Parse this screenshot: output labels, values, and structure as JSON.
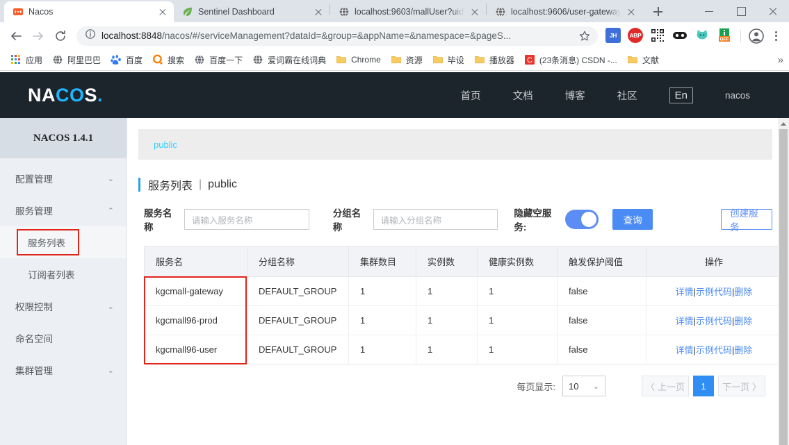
{
  "browser": {
    "tabs": [
      {
        "title": "Nacos",
        "favicon": "nacos-icon",
        "active": true
      },
      {
        "title": "Sentinel Dashboard",
        "favicon": "leaf-icon",
        "active": false
      },
      {
        "title": "localhost:9603/mallUser?uid",
        "favicon": "globe-icon",
        "active": false
      },
      {
        "title": "localhost:9606/user-gateway",
        "favicon": "globe-icon",
        "active": false
      }
    ],
    "new_tab_label": "+",
    "window_controls": {
      "minimize": "minimize-icon",
      "maximize": "maximize-icon",
      "close": "close-icon"
    },
    "omnibox": {
      "host": "localhost:8848",
      "path": "/nacos/#/serviceManagement?dataId=&group=&appName=&namespace=&pageS...",
      "info_icon": "info-circle-icon",
      "bookmark_icon": "star-icon"
    },
    "nav": {
      "back": "back-arrow-icon",
      "forward": "forward-arrow-icon",
      "reload": "reload-icon"
    },
    "extensions": [
      {
        "name": "JH",
        "label": "JH",
        "color": "#3f6fd8"
      },
      {
        "name": "ABP",
        "label": "ABP",
        "color": "#e02a2a"
      },
      {
        "name": "qr-code",
        "label": "",
        "color": "#2b2b2b"
      },
      {
        "name": "pocket",
        "label": "",
        "color": "#1a1a1a"
      },
      {
        "name": "cat",
        "label": "",
        "color": "#49c9bc"
      },
      {
        "name": "proxy-off",
        "label": "OFF",
        "color": "#1aa052"
      }
    ],
    "profile_icon": "account-circle-icon",
    "menu_icon": "three-dots-icon",
    "bookmarks": [
      {
        "label": "应用",
        "icon": "apps-grid-icon"
      },
      {
        "label": "阿里巴巴",
        "icon": "globe-icon"
      },
      {
        "label": "百度",
        "icon": "baidu-paw-icon"
      },
      {
        "label": "搜索",
        "icon": "search-o-icon"
      },
      {
        "label": "百度一下",
        "icon": "globe-icon"
      },
      {
        "label": "爱词霸在线词典",
        "icon": "globe-icon"
      },
      {
        "label": "Chrome",
        "icon": "folder-icon"
      },
      {
        "label": "资源",
        "icon": "folder-icon"
      },
      {
        "label": "毕设",
        "icon": "folder-icon"
      },
      {
        "label": "播放器",
        "icon": "folder-icon"
      },
      {
        "label": "(23条消息) CSDN -...",
        "icon": "csdn-icon"
      },
      {
        "label": "文献",
        "icon": "folder-icon"
      }
    ],
    "bookmarks_overflow": "»"
  },
  "nacos": {
    "logo": {
      "part1": "NA",
      "part2": "CO",
      "part3": "S",
      "dot": "."
    },
    "topnav": [
      {
        "label": "首页"
      },
      {
        "label": "文档"
      },
      {
        "label": "博客"
      },
      {
        "label": "社区"
      }
    ],
    "lang_button": "En",
    "username": "nacos",
    "sidebar": {
      "title": "NACOS 1.4.1",
      "items": [
        {
          "label": "配置管理",
          "chevron": "⌄",
          "type": "group"
        },
        {
          "label": "服务管理",
          "chevron": "⌃",
          "type": "group"
        },
        {
          "label": "服务列表",
          "type": "sub",
          "selected": true
        },
        {
          "label": "订阅者列表",
          "type": "sub",
          "selected": false
        },
        {
          "label": "权限控制",
          "chevron": "⌄",
          "type": "group"
        },
        {
          "label": "命名空间",
          "chevron": "",
          "type": "group"
        },
        {
          "label": "集群管理",
          "chevron": "⌄",
          "type": "group"
        }
      ]
    },
    "breadcrumb": "public",
    "page_title": {
      "text": "服务列表",
      "separator": "|",
      "namespace": "public"
    },
    "filters": {
      "service_name_label": "服务名称",
      "service_name_placeholder": "请输入服务名称",
      "service_name_value": "",
      "group_name_label": "分组名称",
      "group_name_placeholder": "请输入分组名称",
      "group_name_value": "",
      "hide_empty_label": "隐藏空服务:",
      "hide_empty_on": true,
      "query_button": "查询",
      "create_button": "创建服务"
    },
    "table": {
      "columns": [
        "服务名",
        "分组名称",
        "集群数目",
        "实例数",
        "健康实例数",
        "触发保护阈值",
        "操作"
      ],
      "rows": [
        {
          "service": "kgcmall-gateway",
          "group": "DEFAULT_GROUP",
          "clusters": "1",
          "instances": "1",
          "healthy": "1",
          "threshold": "false",
          "ops": [
            "详情",
            "示例代码",
            "删除"
          ]
        },
        {
          "service": "kgcmall96-prod",
          "group": "DEFAULT_GROUP",
          "clusters": "1",
          "instances": "1",
          "healthy": "1",
          "threshold": "false",
          "ops": [
            "详情",
            "示例代码",
            "删除"
          ]
        },
        {
          "service": "kgcmall96-user",
          "group": "DEFAULT_GROUP",
          "clusters": "1",
          "instances": "1",
          "healthy": "1",
          "threshold": "false",
          "ops": [
            "详情",
            "示例代码",
            "删除"
          ]
        }
      ],
      "op_separator": "|"
    },
    "pagination": {
      "page_size_label": "每页显示:",
      "page_size_value": "10",
      "prev_label": "上一页",
      "next_label": "下一页",
      "prev_chevron": "〈",
      "next_chevron": "〉",
      "current_page": "1"
    },
    "annotations": [
      {
        "name": "service-name-column-highlight",
        "color": "#e1251b"
      },
      {
        "name": "sidebar-service-list-highlight",
        "color": "#e1251b"
      }
    ],
    "colors": {
      "accent_blue": "#4b8bf4",
      "logo_blue": "#1fb6ff",
      "header_dark": "#1d252c",
      "annotation_red": "#e1251b",
      "breadcrumb_cyan": "#33cfff"
    }
  }
}
